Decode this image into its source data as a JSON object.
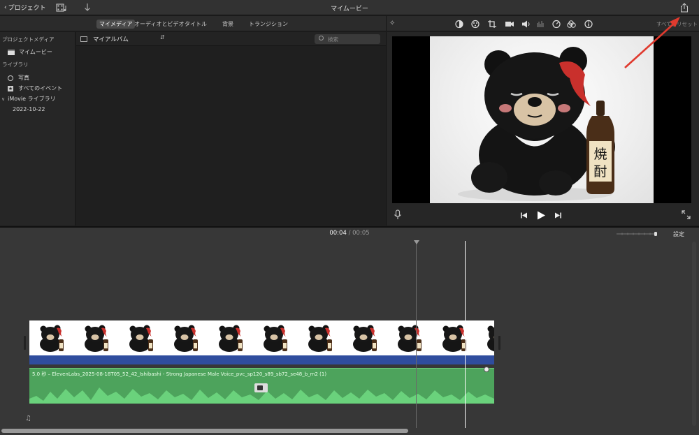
{
  "toolbar": {
    "back_label": "プロジェクト",
    "title": "マイムービー",
    "share_icon": "share-icon",
    "film_icon": "film-music-icon",
    "import_icon": "import-arrow-icon"
  },
  "browser": {
    "tabs": [
      {
        "label": "マイメディア",
        "active": true
      },
      {
        "label": "オーディオとビデオ",
        "active": false
      },
      {
        "label": "タイトル",
        "active": false
      },
      {
        "label": "背景",
        "active": false
      },
      {
        "label": "トランジション",
        "active": false
      }
    ],
    "album_label": "マイアルバム",
    "search_placeholder": "検索"
  },
  "sidebar": {
    "project_media_header": "プロジェクトメディア",
    "project_item": "マイムービー",
    "library_header": "ライブラリ",
    "photos_item": "写真",
    "all_events_item": "すべてのイベント",
    "imovie_library": "iMovie ライブラリ",
    "event_date": "2022-10-22"
  },
  "viewer": {
    "reset_label": "すべてをリセット",
    "image_text": "焼酎"
  },
  "timeline": {
    "current_time": "00:04",
    "separator": "/",
    "total_time": "00:05",
    "settings_label": "設定",
    "audio_clip_label": "5.0 秒 – ElevenLabs_2025-08-18T05_52_42_Ishibashi - Strong Japanese Male Voice_pvc_sp120_s89_sb72_se48_b_m2 (1)",
    "thumbnail_count": 11
  },
  "colors": {
    "video_clip_bar": "#2f4d9e",
    "audio_clip": "#4da35c",
    "annotation_arrow": "#e03a2e"
  }
}
